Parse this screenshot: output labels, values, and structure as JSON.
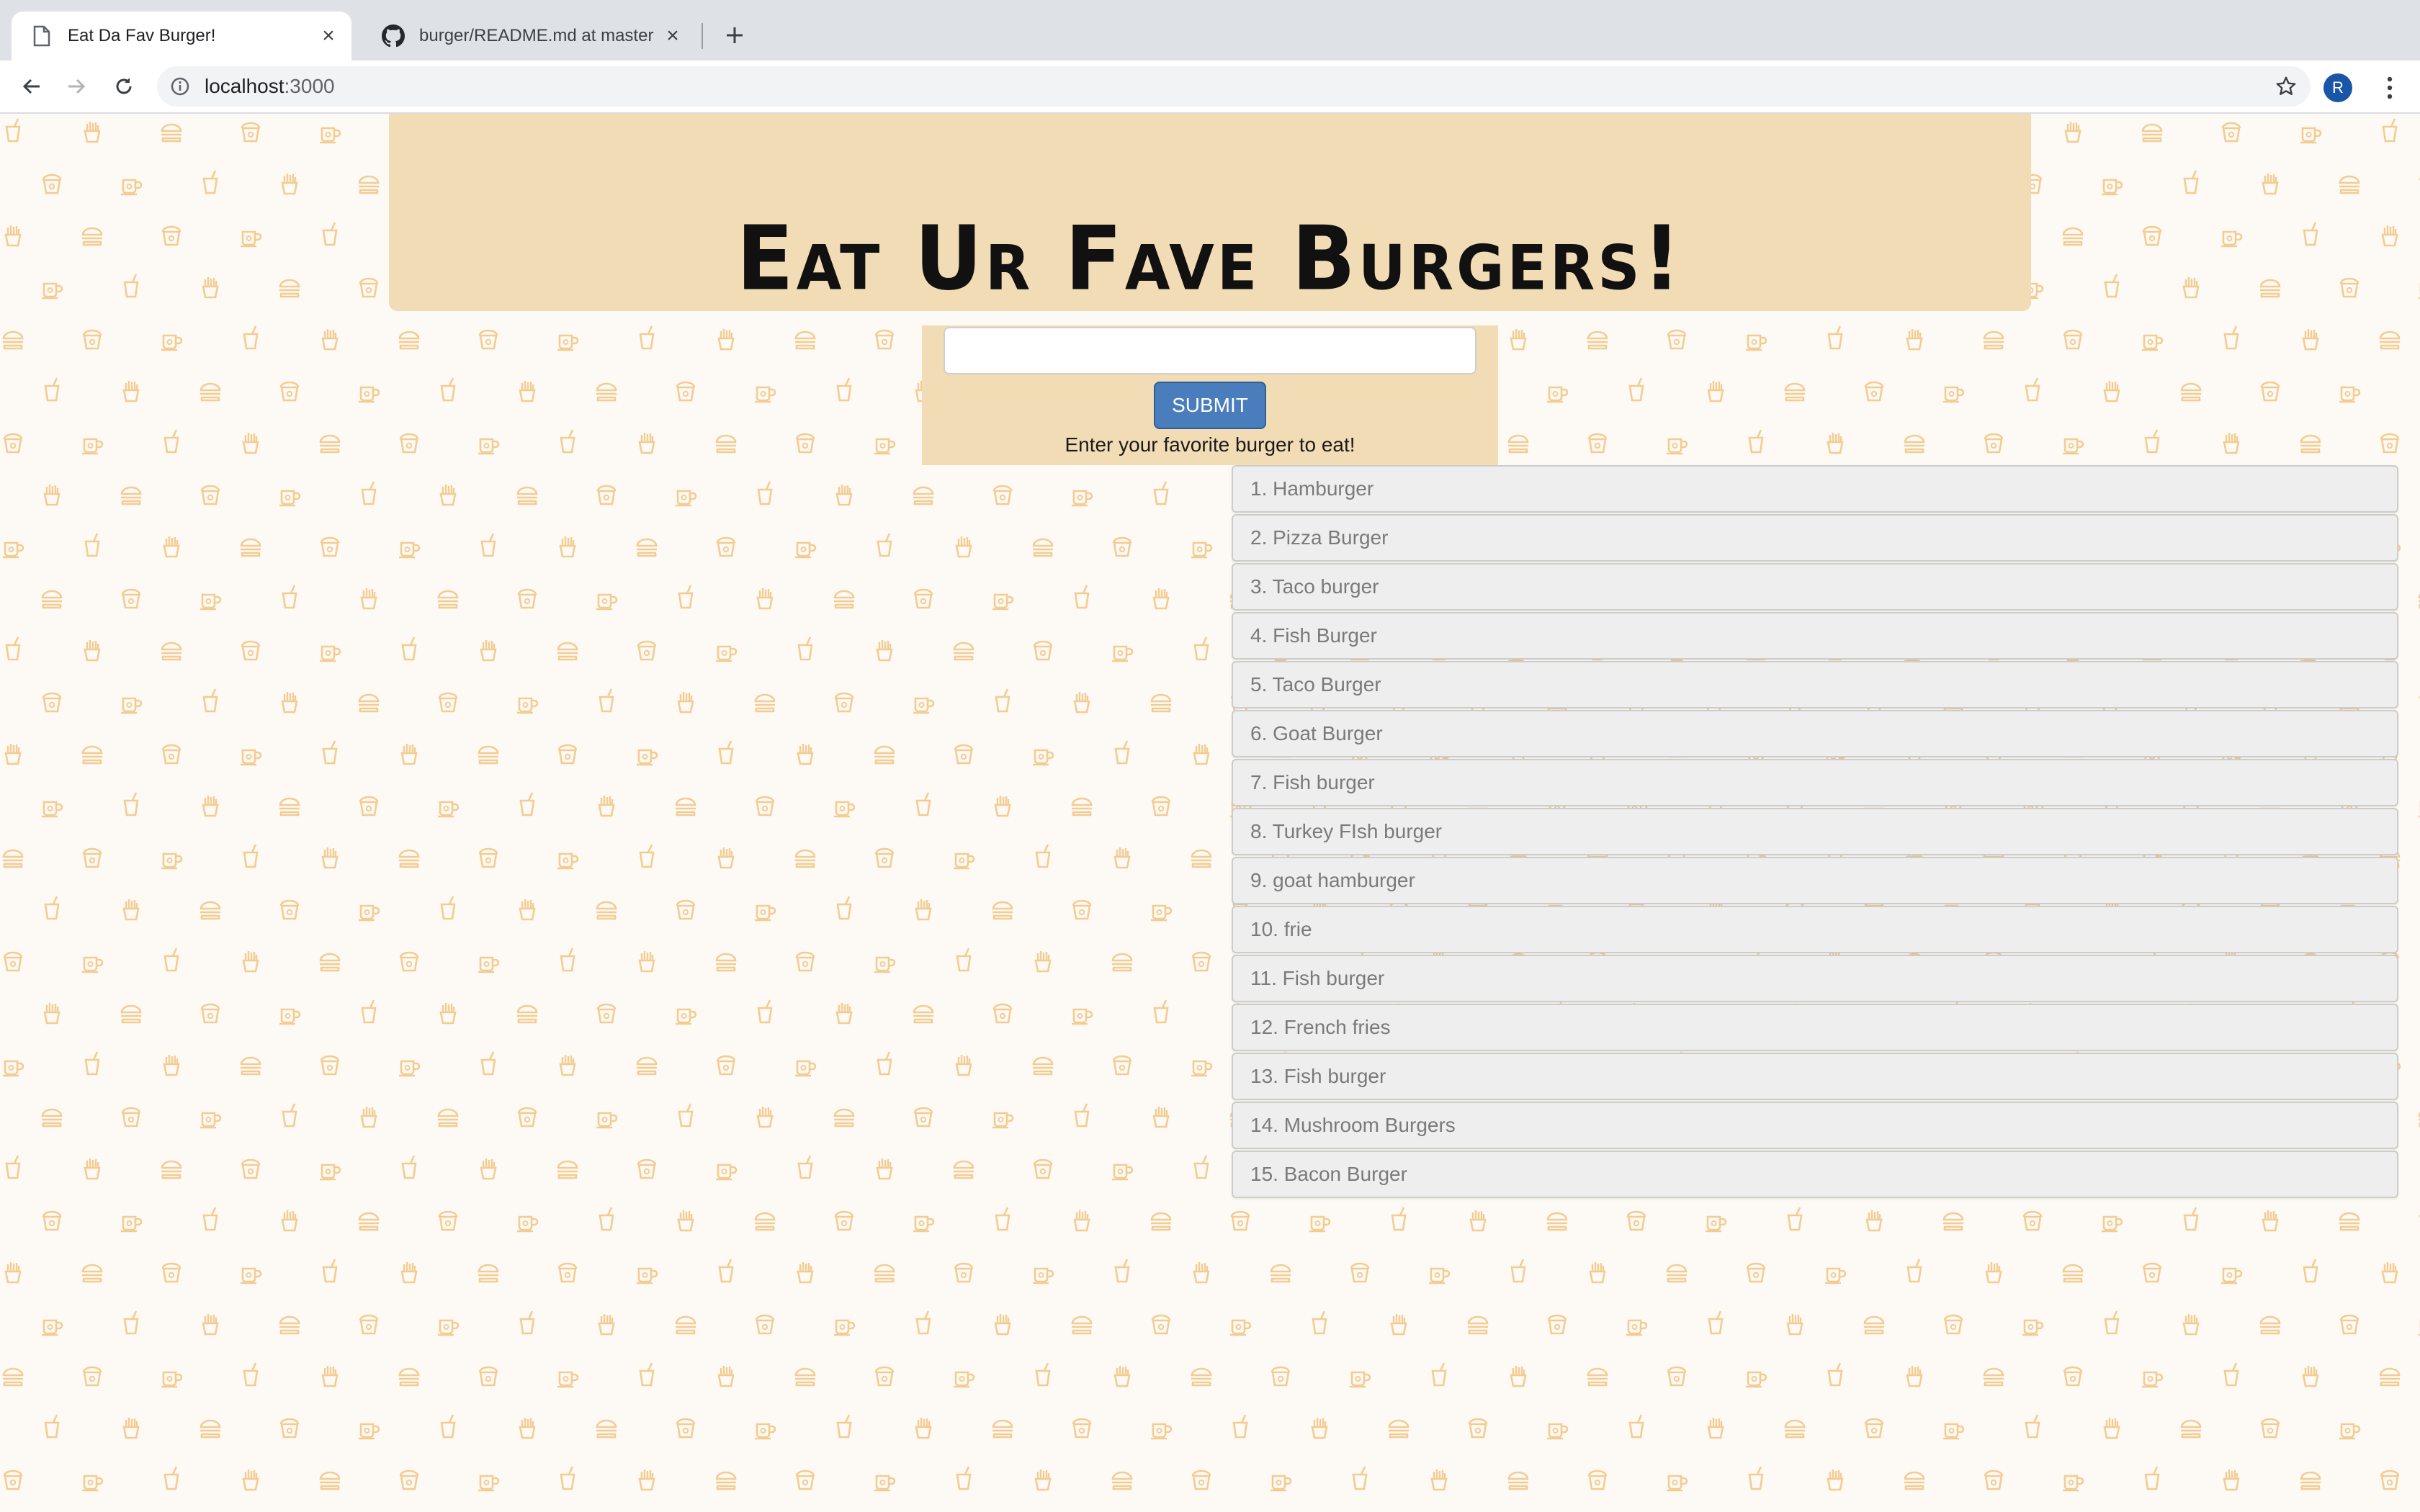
{
  "browser": {
    "tabs": [
      {
        "title": "Eat Da Fav Burger!",
        "icon": "page-icon",
        "active": true
      },
      {
        "title": "burger/README.md at master",
        "icon": "github-icon",
        "active": false
      }
    ],
    "url_host": "localhost",
    "url_port": ":3000",
    "profile_initial": "R",
    "profile_color": "#1a56a8"
  },
  "header": {
    "title": "Eat Ur Fave Burgers!"
  },
  "form": {
    "input_value": "",
    "submit_label": "SUBMIT",
    "hint": "Enter your favorite burger to eat!"
  },
  "burgers": [
    "1. Hamburger",
    "2. Pizza Burger",
    "3. Taco burger",
    "4. Fish Burger",
    "5. Taco Burger",
    "6. Goat Burger",
    "7. Fish burger",
    "8. Turkey FIsh burger",
    "9. goat hamburger",
    "10. frie",
    "11. Fish burger",
    "12. French fries",
    "13. Fish burger",
    "14. Mushroom Burgers",
    "15. Bacon Burger"
  ],
  "theme": {
    "panel_color": "#f2dcb5",
    "pattern_color": "#f3c98a",
    "button_color": "#4a7dbb"
  }
}
